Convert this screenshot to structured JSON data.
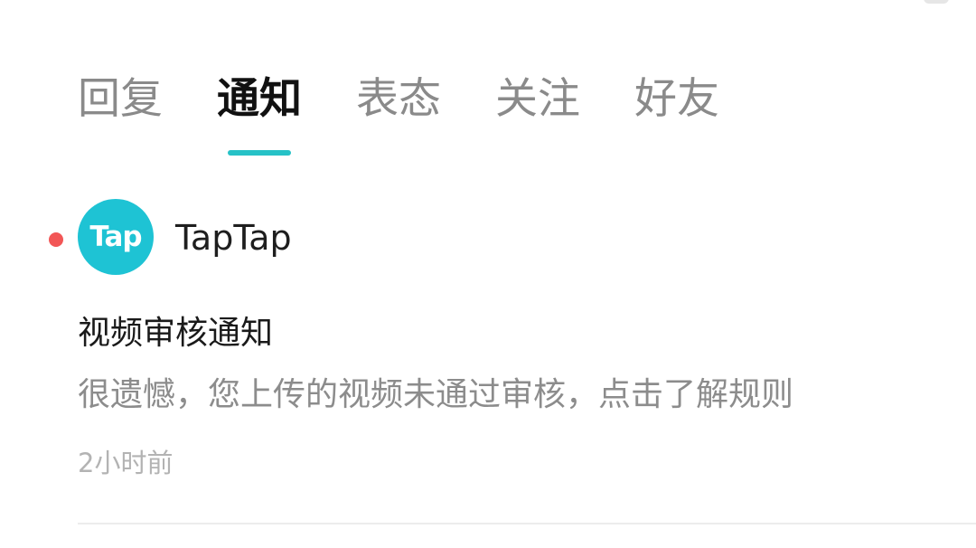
{
  "tabs": [
    {
      "label": "回复",
      "active": false
    },
    {
      "label": "通知",
      "active": true
    },
    {
      "label": "表态",
      "active": false
    },
    {
      "label": "关注",
      "active": false
    },
    {
      "label": "好友",
      "active": false
    }
  ],
  "notification": {
    "sender": "TapTap",
    "avatar_text": "Tap",
    "title": "视频审核通知",
    "body": "很遗憾，您上传的视频未通过审核，点击了解规则",
    "time": "2小时前",
    "unread": true
  },
  "colors": {
    "accent": "#26c2c7",
    "unread_dot": "#f25656",
    "avatar_bg": "#1ec3d4"
  }
}
